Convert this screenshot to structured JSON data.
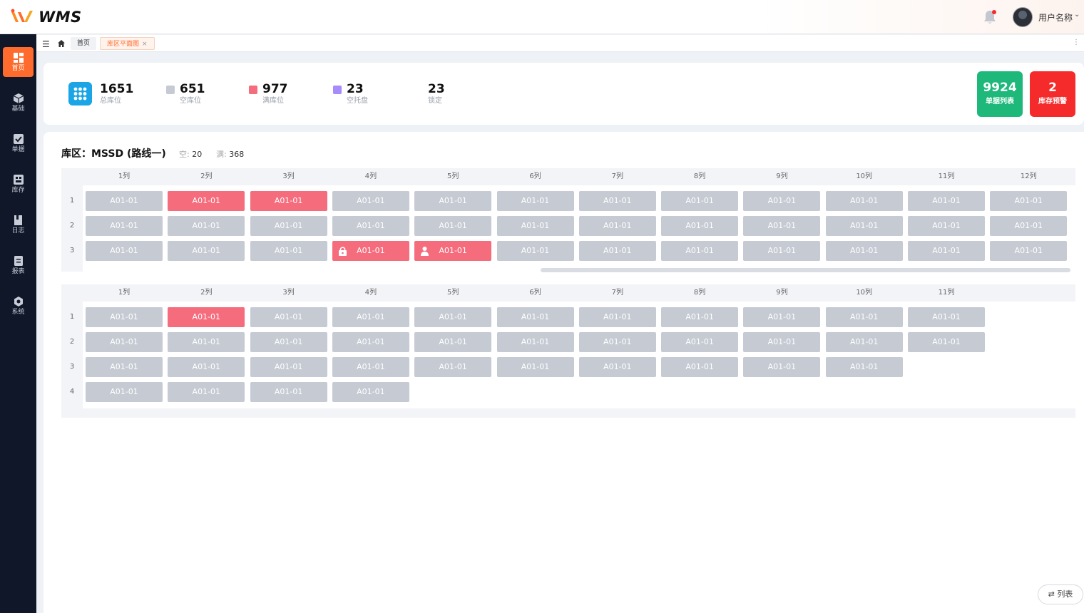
{
  "app": {
    "logo_text": "WMS",
    "brand_color": "#ff6b2c"
  },
  "user": {
    "name": "用户名称",
    "has_notification": true
  },
  "sidebar": {
    "items": [
      {
        "label": "首页",
        "icon": "dashboard-icon",
        "active": true
      },
      {
        "label": "基础",
        "icon": "cube-icon",
        "active": false
      },
      {
        "label": "单据",
        "icon": "checkbox-icon",
        "active": false
      },
      {
        "label": "库存",
        "icon": "inventory-icon",
        "active": false
      },
      {
        "label": "日志",
        "icon": "book-icon",
        "active": false
      },
      {
        "label": "报表",
        "icon": "report-icon",
        "active": false
      },
      {
        "label": "系统",
        "icon": "settings-icon",
        "active": false
      }
    ]
  },
  "tabs": [
    {
      "label": "首页",
      "active": false
    },
    {
      "label": "库区平面图",
      "active": true,
      "close": "×"
    }
  ],
  "stats": {
    "total": {
      "value": "1651",
      "label": "总库位"
    },
    "empty": {
      "value": "651",
      "label": "空库位",
      "color": "#c5cad3"
    },
    "full": {
      "value": "977",
      "label": "满库位",
      "color": "#f56c7d"
    },
    "empty_pallet": {
      "value": "23",
      "label": "空托盘",
      "color": "#a78bfa"
    },
    "locked": {
      "value": "23",
      "label": "锁定"
    }
  },
  "actions": {
    "orders": {
      "value": "9924",
      "label": "单据列表",
      "color": "#1db87a"
    },
    "alerts": {
      "value": "2",
      "label": "库存预警",
      "color": "#f52a2a"
    }
  },
  "zone": {
    "title": "库区：MSSD (路线一)",
    "empty_key": "空:",
    "empty_value": "20",
    "full_key": "满:",
    "full_value": "368"
  },
  "grid1": {
    "columns": [
      "1列",
      "2列",
      "3列",
      "4列",
      "5列",
      "6列",
      "7列",
      "8列",
      "9列",
      "10列",
      "11列",
      "12列"
    ],
    "rows": [
      {
        "label": "1",
        "cells": [
          {
            "text": "A01-01",
            "state": "empty"
          },
          {
            "text": "A01-01",
            "state": "full"
          },
          {
            "text": "A01-01",
            "state": "full"
          },
          {
            "text": "A01-01",
            "state": "empty"
          },
          {
            "text": "A01-01",
            "state": "empty"
          },
          {
            "text": "A01-01",
            "state": "empty"
          },
          {
            "text": "A01-01",
            "state": "empty"
          },
          {
            "text": "A01-01",
            "state": "empty"
          },
          {
            "text": "A01-01",
            "state": "empty"
          },
          {
            "text": "A01-01",
            "state": "empty"
          },
          {
            "text": "A01-01",
            "state": "empty"
          },
          {
            "text": "A01-01",
            "state": "empty"
          }
        ]
      },
      {
        "label": "2",
        "cells": [
          {
            "text": "A01-01",
            "state": "empty"
          },
          {
            "text": "A01-01",
            "state": "empty"
          },
          {
            "text": "A01-01",
            "state": "empty"
          },
          {
            "text": "A01-01",
            "state": "empty"
          },
          {
            "text": "A01-01",
            "state": "empty"
          },
          {
            "text": "A01-01",
            "state": "empty"
          },
          {
            "text": "A01-01",
            "state": "empty"
          },
          {
            "text": "A01-01",
            "state": "empty"
          },
          {
            "text": "A01-01",
            "state": "empty"
          },
          {
            "text": "A01-01",
            "state": "empty"
          },
          {
            "text": "A01-01",
            "state": "empty"
          },
          {
            "text": "A01-01",
            "state": "empty"
          }
        ]
      },
      {
        "label": "3",
        "cells": [
          {
            "text": "A01-01",
            "state": "empty"
          },
          {
            "text": "A01-01",
            "state": "empty"
          },
          {
            "text": "A01-01",
            "state": "empty"
          },
          {
            "text": "A01-01",
            "state": "full",
            "icon": "lock-icon"
          },
          {
            "text": "A01-01",
            "state": "full",
            "icon": "user-icon"
          },
          {
            "text": "A01-01",
            "state": "empty"
          },
          {
            "text": "A01-01",
            "state": "empty"
          },
          {
            "text": "A01-01",
            "state": "empty"
          },
          {
            "text": "A01-01",
            "state": "empty"
          },
          {
            "text": "A01-01",
            "state": "empty"
          },
          {
            "text": "A01-01",
            "state": "empty"
          },
          {
            "text": "A01-01",
            "state": "empty"
          }
        ]
      }
    ]
  },
  "grid2": {
    "columns": [
      "1列",
      "2列",
      "3列",
      "4列",
      "5列",
      "6列",
      "7列",
      "8列",
      "9列",
      "10列",
      "11列"
    ],
    "rows": [
      {
        "label": "1",
        "cells": [
          {
            "text": "A01-01",
            "state": "empty"
          },
          {
            "text": "A01-01",
            "state": "full"
          },
          {
            "text": "A01-01",
            "state": "empty"
          },
          {
            "text": "A01-01",
            "state": "empty"
          },
          {
            "text": "A01-01",
            "state": "empty"
          },
          {
            "text": "A01-01",
            "state": "empty"
          },
          {
            "text": "A01-01",
            "state": "empty"
          },
          {
            "text": "A01-01",
            "state": "empty"
          },
          {
            "text": "A01-01",
            "state": "empty"
          },
          {
            "text": "A01-01",
            "state": "empty"
          },
          {
            "text": "A01-01",
            "state": "empty"
          }
        ]
      },
      {
        "label": "2",
        "cells": [
          {
            "text": "A01-01",
            "state": "empty"
          },
          {
            "text": "A01-01",
            "state": "empty"
          },
          {
            "text": "A01-01",
            "state": "empty"
          },
          {
            "text": "A01-01",
            "state": "empty"
          },
          {
            "text": "A01-01",
            "state": "empty"
          },
          {
            "text": "A01-01",
            "state": "empty"
          },
          {
            "text": "A01-01",
            "state": "empty"
          },
          {
            "text": "A01-01",
            "state": "empty"
          },
          {
            "text": "A01-01",
            "state": "empty"
          },
          {
            "text": "A01-01",
            "state": "empty"
          },
          {
            "text": "A01-01",
            "state": "empty"
          }
        ]
      },
      {
        "label": "3",
        "cells": [
          {
            "text": "A01-01",
            "state": "empty"
          },
          {
            "text": "A01-01",
            "state": "empty"
          },
          {
            "text": "A01-01",
            "state": "empty"
          },
          {
            "text": "A01-01",
            "state": "empty"
          },
          {
            "text": "A01-01",
            "state": "empty"
          },
          {
            "text": "A01-01",
            "state": "empty"
          },
          {
            "text": "A01-01",
            "state": "empty"
          },
          {
            "text": "A01-01",
            "state": "empty"
          },
          {
            "text": "A01-01",
            "state": "empty"
          },
          {
            "text": "A01-01",
            "state": "empty"
          }
        ]
      },
      {
        "label": "4",
        "cells": [
          {
            "text": "A01-01",
            "state": "empty"
          },
          {
            "text": "A01-01",
            "state": "empty"
          },
          {
            "text": "A01-01",
            "state": "empty"
          },
          {
            "text": "A01-01",
            "state": "empty"
          }
        ]
      }
    ]
  },
  "list_toggle": {
    "label": "列表",
    "icon": "swap-icon"
  }
}
